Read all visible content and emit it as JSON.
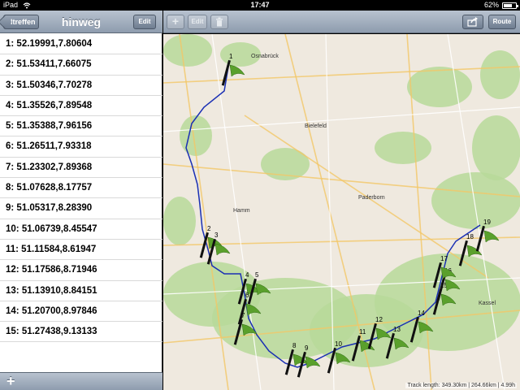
{
  "status_bar": {
    "carrier": "iPad",
    "time": "17:47",
    "battery_percent": "62%",
    "battery_level": 0.62
  },
  "left_panel": {
    "back_label": "ltreffen",
    "title": "hinweg",
    "edit_label": "Edit",
    "points": [
      "1: 52.19991,7.80604",
      "2: 51.53411,7.66075",
      "3: 51.50346,7.70278",
      "4: 51.35526,7.89548",
      "5: 51.35388,7.96156",
      "6: 51.26511,7.93318",
      "7: 51.23302,7.89368",
      "8: 51.07628,8.17757",
      "9: 51.05317,8.28390",
      "10: 51.06739,8.45547",
      "11: 51.11584,8.61947",
      "12: 51.17586,8.71946",
      "13: 51.13910,8.84151",
      "14: 51.20700,8.97846",
      "15: 51.27438,9.13133"
    ],
    "add_label": "+"
  },
  "toolbar": {
    "add_label": "+",
    "edit_label": "Edit",
    "share_icon": "share-icon",
    "trash_icon": "trash-icon",
    "route_label": "Route"
  },
  "map": {
    "city_labels": [
      "Osnabrück",
      "Bielefeld",
      "Hamm",
      "Paderborn",
      "Kassel"
    ],
    "waypoints": [
      "1",
      "2",
      "3",
      "4",
      "5",
      "6",
      "7",
      "8",
      "9",
      "10",
      "11",
      "12",
      "13",
      "14",
      "15",
      "16",
      "17",
      "18",
      "19"
    ],
    "track_info": "Track length: 349.30km | 264.66km | 4.99h",
    "colors": {
      "track": "#1a2fb4",
      "flag": "#5aa02c",
      "forest": "#b7d99a"
    }
  }
}
